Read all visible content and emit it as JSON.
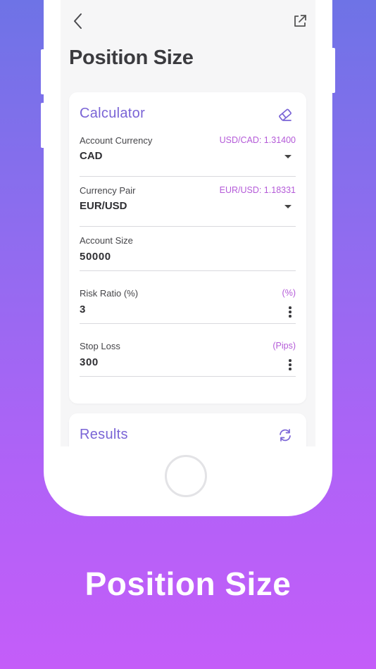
{
  "screen": {
    "title": "Position Size"
  },
  "calculator": {
    "title": "Calculator",
    "fields": [
      {
        "label": "Account Currency",
        "value": "CAD",
        "rate": "USD/CAD: 1.31400"
      },
      {
        "label": "Currency Pair",
        "value": "EUR/USD",
        "rate": "EUR/USD: 1.18331"
      },
      {
        "label": "Account Size",
        "value": "50000"
      },
      {
        "label": "Risk Ratio (%)",
        "value": "3",
        "unit": "(%)"
      },
      {
        "label": "Stop Loss",
        "value": "300",
        "unit": "(Pips)"
      }
    ]
  },
  "results": {
    "title": "Results"
  },
  "promo": {
    "caption": "Position Size"
  },
  "colors": {
    "accent": "#7a64d6",
    "rate_text": "#b45ad8",
    "background_top": "#6e73e6",
    "background_bottom": "#c45df9"
  },
  "icons": [
    "back-arrow-icon",
    "share-icon",
    "eraser-icon",
    "refresh-icon",
    "dropdown-caret-icon",
    "more-vert-icon"
  ]
}
